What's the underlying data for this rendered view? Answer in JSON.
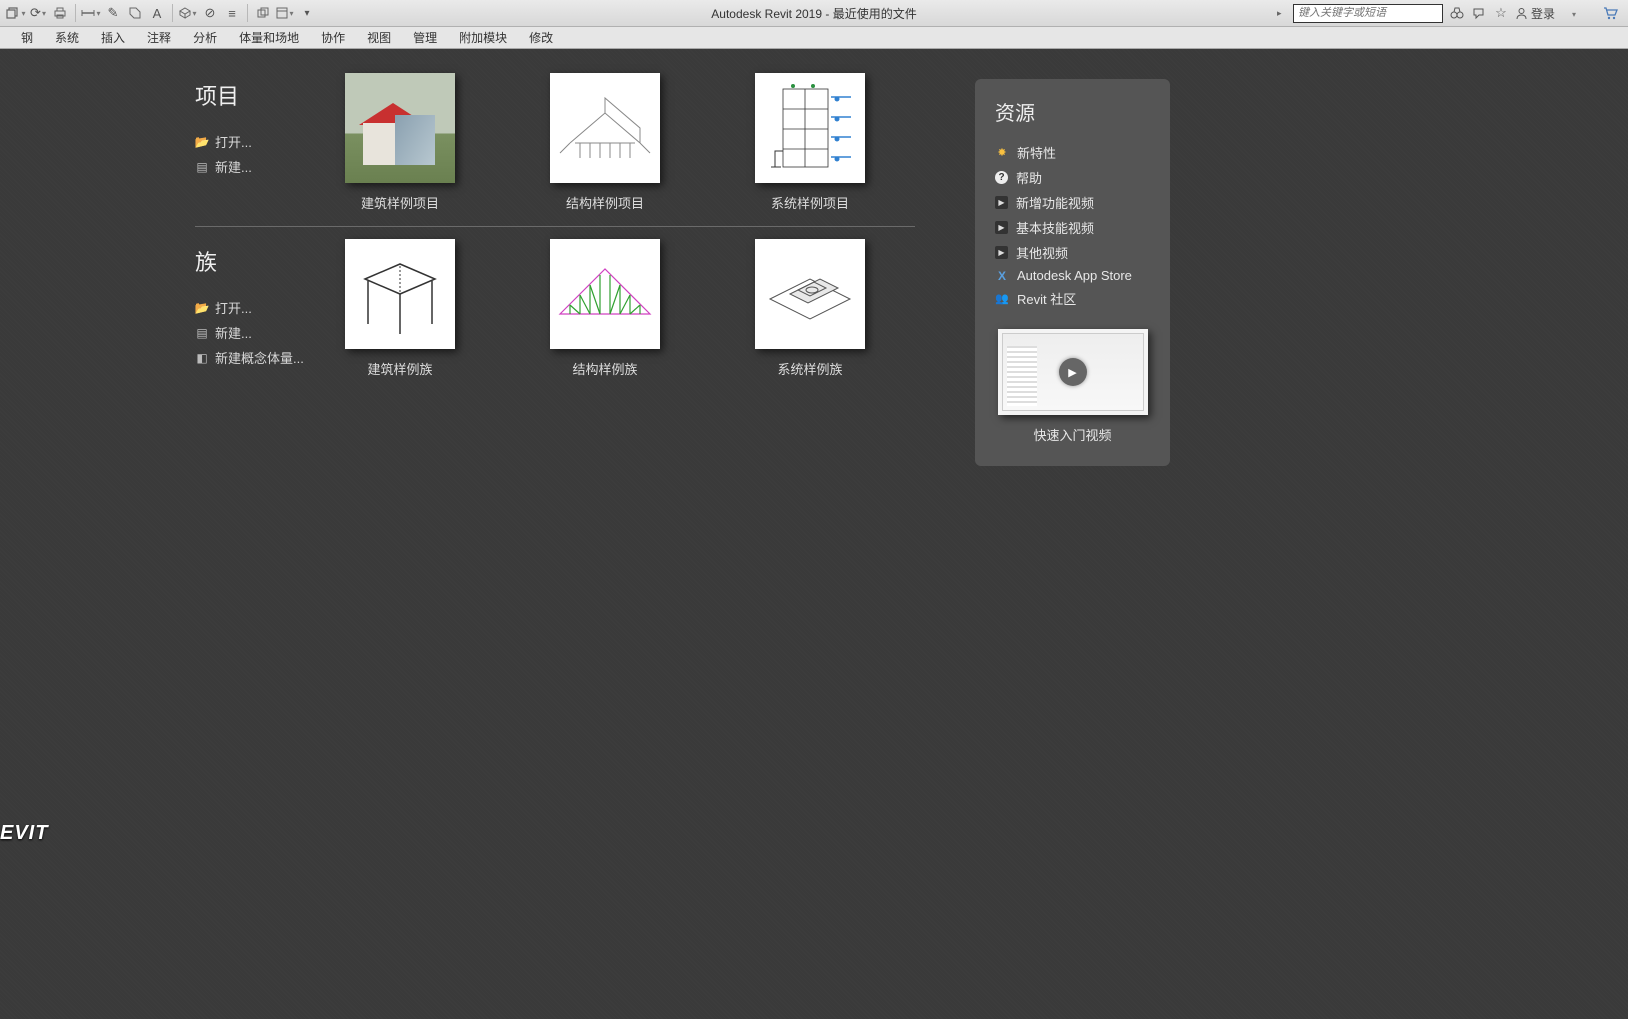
{
  "title": "Autodesk Revit 2019 - 最近使用的文件",
  "search_placeholder": "键入关键字或短语",
  "signin_label": "登录",
  "ribbon_tabs": [
    "钢",
    "系统",
    "插入",
    "注释",
    "分析",
    "体量和场地",
    "协作",
    "视图",
    "管理",
    "附加模块",
    "修改"
  ],
  "sections": {
    "projects": {
      "title": "项目",
      "links": [
        {
          "label": "打开...",
          "icon": "folder"
        },
        {
          "label": "新建...",
          "icon": "file"
        }
      ],
      "cards": [
        {
          "label": "建筑样例项目"
        },
        {
          "label": "结构样例项目"
        },
        {
          "label": "系统样例项目"
        }
      ]
    },
    "families": {
      "title": "族",
      "links": [
        {
          "label": "打开...",
          "icon": "folder"
        },
        {
          "label": "新建...",
          "icon": "file"
        },
        {
          "label": "新建概念体量...",
          "icon": "mass"
        }
      ],
      "cards": [
        {
          "label": "建筑样例族"
        },
        {
          "label": "结构样例族"
        },
        {
          "label": "系统样例族"
        }
      ]
    }
  },
  "resources": {
    "title": "资源",
    "links": [
      {
        "label": "新特性",
        "icon": "star"
      },
      {
        "label": "帮助",
        "icon": "help"
      },
      {
        "label": "新增功能视频",
        "icon": "play"
      },
      {
        "label": "基本技能视频",
        "icon": "play"
      },
      {
        "label": "其他视频",
        "icon": "play"
      },
      {
        "label": "Autodesk App Store",
        "icon": "x"
      },
      {
        "label": "Revit 社区",
        "icon": "group"
      }
    ],
    "video_label": "快速入门视频"
  },
  "brand": "EVIT"
}
